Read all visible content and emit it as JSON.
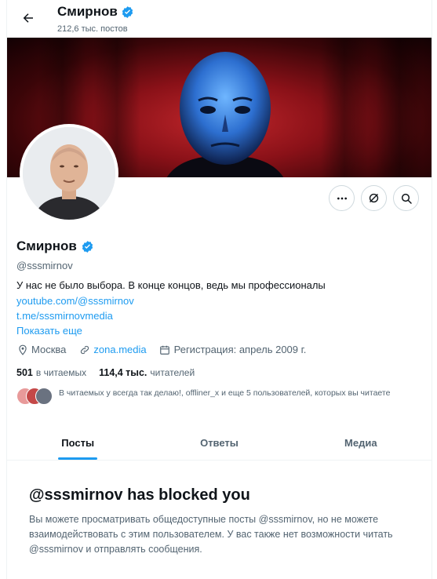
{
  "header": {
    "back_icon": "arrow-left-icon",
    "name": "Смирнов",
    "posts_count": "212,6 тыс. постов"
  },
  "profile": {
    "name": "Смирнов",
    "handle": "@sssmirnov",
    "bio": "У нас не было выбора. В конце концов, ведь мы профессионалы",
    "links": [
      "youtube.com/@sssmirnov",
      "t.me/sssmirnovmedia"
    ],
    "show_more": "Показать еще",
    "location": "Москва",
    "website": "zona.media",
    "joined": "Регистрация: апрель 2009 г.",
    "following_count": "501",
    "following_label": "в читаемых",
    "followers_count": "114,4 тыс.",
    "followers_label": "читателей",
    "followed_by_text": "В читаемых у всегда так делаю!, offliner_x и еще 5 пользователей, которых вы читаете"
  },
  "actions": {
    "more_icon": "more-icon",
    "notify_icon": "notifications-off-icon",
    "search_icon": "search-icon"
  },
  "tabs": [
    {
      "label": "Посты",
      "active": true
    },
    {
      "label": "Ответы",
      "active": false
    },
    {
      "label": "Медиа",
      "active": false
    }
  ],
  "blocked": {
    "title": "@sssmirnov has blocked you",
    "message": "Вы можете просматривать общедоступные посты @sssmirnov, но не можете взаимодействовать с этим пользователем. У вас также нет возможности читать @sssmirnov и отправлять сообщения."
  },
  "colors": {
    "accent": "#1d9bf0",
    "text_primary": "#0f1419",
    "text_secondary": "#536471"
  }
}
